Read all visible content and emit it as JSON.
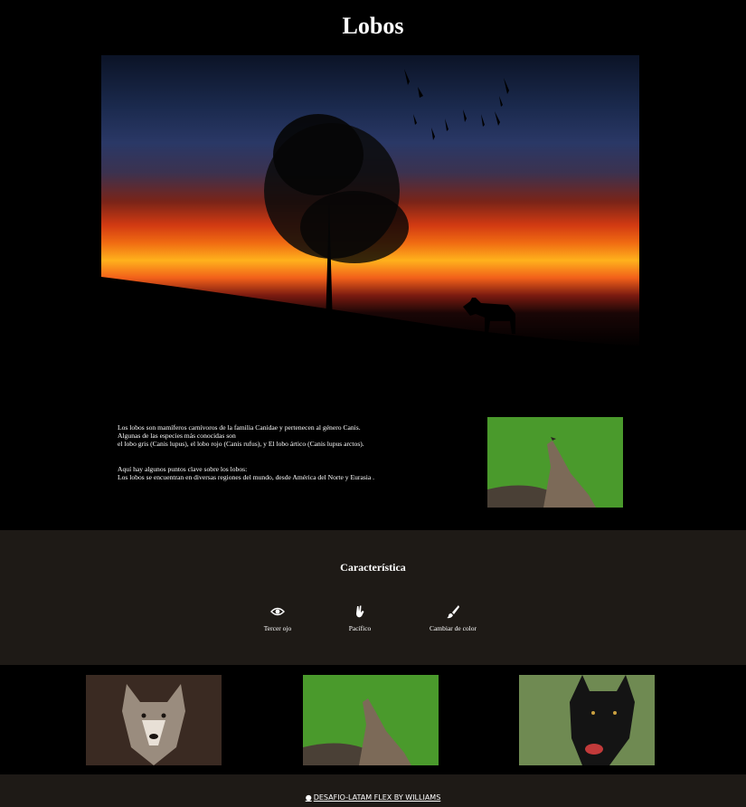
{
  "header": {
    "title": "Lobos"
  },
  "intro": {
    "paragraph1": [
      "Los lobos son mamíferos carnívoros de la familia Canidae y pertenecen al género Canis.",
      "Algunas de las especies más conocidas son",
      "el lobo gris (Canis lupus), el lobo rojo (Canis rufus), y El lobo ártico (Canis lupus arctos)."
    ],
    "paragraph2": [
      "Aquí hay algunos puntos clave sobre los lobos:",
      "Los lobos se encuentran en diversas regiones del mundo, desde América del Norte y Eurasia ."
    ]
  },
  "features": {
    "title": "Característica",
    "items": [
      {
        "label": "Tercer ojo",
        "icon": "eye-icon"
      },
      {
        "label": "Pacífico",
        "icon": "peace-hand-icon"
      },
      {
        "label": "Cambiar de color",
        "icon": "paintbrush-icon"
      }
    ]
  },
  "footer": {
    "link_label": "DESAFIO-LATAM FLEX BY WILLIAMS",
    "icon": "github-icon"
  }
}
